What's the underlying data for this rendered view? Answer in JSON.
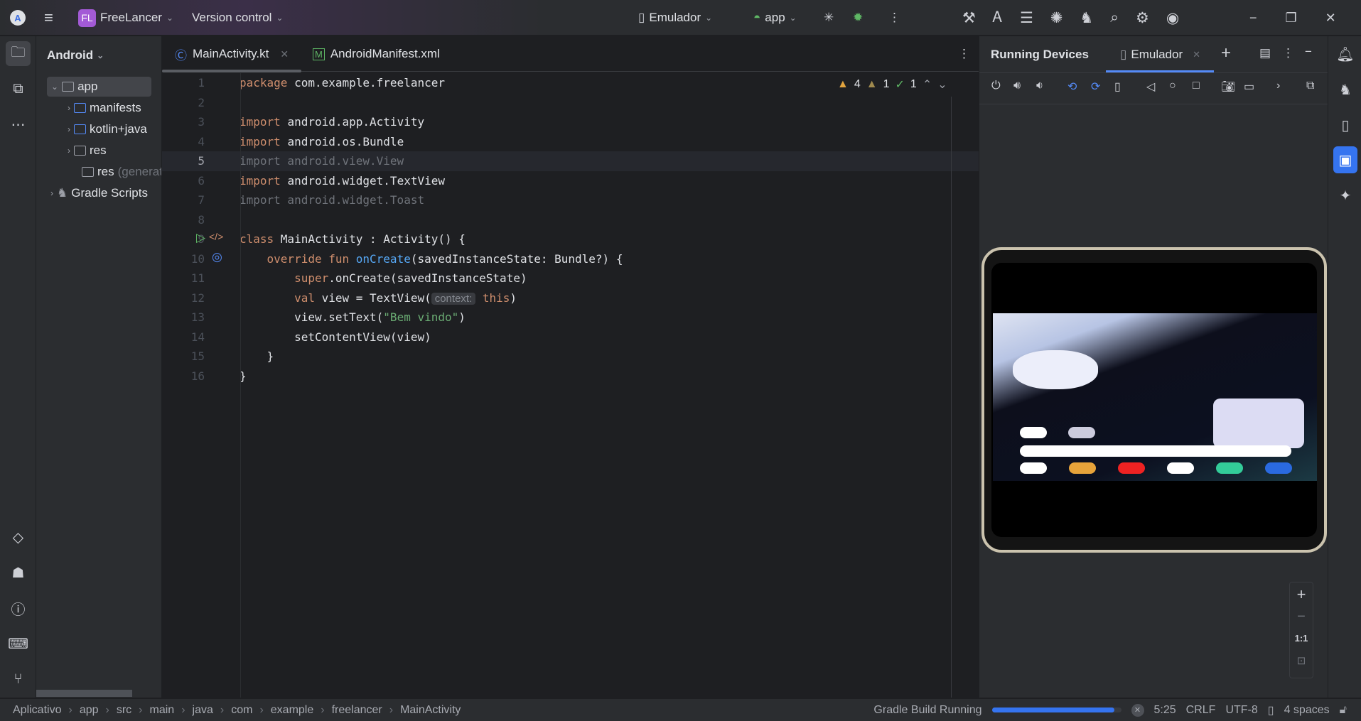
{
  "titlebar": {
    "project_initials": "FL",
    "project_name": "FreeLancer",
    "vcs": "Version control",
    "device": "Emulador",
    "run_config": "app"
  },
  "project_panel": {
    "view": "Android",
    "items": [
      {
        "label": "app",
        "depth": 0,
        "expanded": true,
        "selected": true
      },
      {
        "label": "manifests",
        "depth": 1
      },
      {
        "label": "kotlin+java",
        "depth": 1
      },
      {
        "label": "res",
        "depth": 1
      },
      {
        "label": "res",
        "suffix": "(generated)",
        "depth": 1
      },
      {
        "label": "Gradle Scripts",
        "depth": 0
      }
    ]
  },
  "editor": {
    "tabs": [
      {
        "label": "MainActivity.kt",
        "active": true
      },
      {
        "label": "AndroidManifest.xml",
        "active": false
      }
    ],
    "inspections": {
      "warnings": "4",
      "weak_warnings": "1",
      "typos": "1"
    },
    "current_line": 5,
    "lines": [
      [
        {
          "t": "package ",
          "c": "kw"
        },
        {
          "t": "com.example.freelancer"
        }
      ],
      [],
      [
        {
          "t": "import ",
          "c": "kw"
        },
        {
          "t": "android.app.Activity"
        }
      ],
      [
        {
          "t": "import ",
          "c": "kw"
        },
        {
          "t": "android.os.Bundle"
        }
      ],
      [
        {
          "t": "import android.view.View",
          "c": "dim"
        }
      ],
      [
        {
          "t": "import ",
          "c": "kw"
        },
        {
          "t": "android.widget.TextView"
        }
      ],
      [
        {
          "t": "import android.widget.Toast",
          "c": "dim"
        }
      ],
      [],
      [
        {
          "t": "class ",
          "c": "kw"
        },
        {
          "t": "MainActivity : Activity() {"
        }
      ],
      [
        {
          "t": "    override fun ",
          "c": "kw"
        },
        {
          "t": "onCreate",
          "c": "fn"
        },
        {
          "t": "(savedInstanceState: Bundle?) {"
        }
      ],
      [
        {
          "t": "        super",
          "c": "kw"
        },
        {
          "t": ".onCreate(savedInstanceState)"
        }
      ],
      [
        {
          "t": "        val ",
          "c": "kw"
        },
        {
          "t": "view = TextView("
        },
        {
          "t": "context:",
          "c": "hint"
        },
        {
          "t": " this",
          "c": "kw"
        },
        {
          "t": ")"
        }
      ],
      [
        {
          "t": "        view.setText("
        },
        {
          "t": "\"Bem vindo\"",
          "c": "str"
        },
        {
          "t": ")"
        }
      ],
      [
        {
          "t": "        setContentView(view)"
        }
      ],
      [
        {
          "t": "    }"
        }
      ],
      [
        {
          "t": "}"
        }
      ]
    ]
  },
  "running_devices": {
    "title": "Running Devices",
    "tab": "Emulador",
    "zoom_label": "1:1"
  },
  "status": {
    "breadcrumbs": [
      "Aplicativo",
      "app",
      "src",
      "main",
      "java",
      "com",
      "example",
      "freelancer",
      "MainActivity"
    ],
    "task": "Gradle Build Running",
    "progress": 0.95,
    "position": "5:25",
    "line_sep": "CRLF",
    "encoding": "UTF-8",
    "indent": "4 spaces"
  },
  "colors": {
    "accent": "#548af7",
    "keyword": "#cf8e6d",
    "function": "#56a8f5",
    "string": "#6aab73",
    "project_badge": "#a35ad6"
  }
}
